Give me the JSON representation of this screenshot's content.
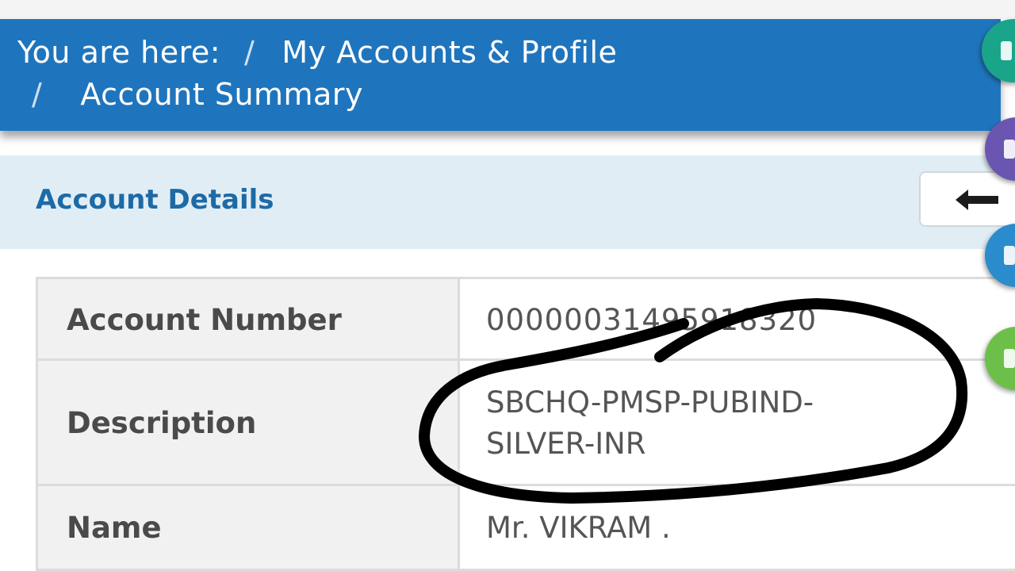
{
  "breadcrumb": {
    "prefix": "You are here:",
    "separator": "/",
    "items": [
      "My Accounts & Profile",
      "Account Summary"
    ]
  },
  "section": {
    "title": "Account Details",
    "back_icon": "arrow-left-icon"
  },
  "details": [
    {
      "label": "Account Number",
      "value": "00000031495918320"
    },
    {
      "label": "Description",
      "value_line1": "SBCHQ-PMSP-PUBIND-",
      "value_line2": "SILVER-INR"
    },
    {
      "label": "Name",
      "value": "Mr. VIKRAM ."
    }
  ],
  "side_icons": [
    {
      "name": "home-icon",
      "color": "#1aa58a"
    },
    {
      "name": "share-icon",
      "color": "#6a55b0"
    },
    {
      "name": "info-icon",
      "color": "#2a8ccc"
    },
    {
      "name": "chat-icon",
      "color": "#6cc04a"
    }
  ],
  "colors": {
    "header_blue": "#1f75bd",
    "section_bg": "#e1edf5",
    "title_blue": "#1d6aa6",
    "annotation_ink": "#000000"
  }
}
